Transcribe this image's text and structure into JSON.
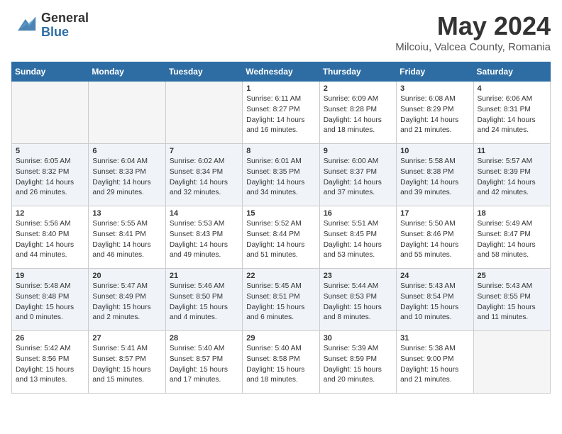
{
  "header": {
    "logo_general": "General",
    "logo_blue": "Blue",
    "month_title": "May 2024",
    "location": "Milcoiu, Valcea County, Romania"
  },
  "days_of_week": [
    "Sunday",
    "Monday",
    "Tuesday",
    "Wednesday",
    "Thursday",
    "Friday",
    "Saturday"
  ],
  "weeks": [
    {
      "cells": [
        {
          "day": null,
          "empty": true
        },
        {
          "day": null,
          "empty": true
        },
        {
          "day": null,
          "empty": true
        },
        {
          "day": 1,
          "sunrise": "6:11 AM",
          "sunset": "8:27 PM",
          "daylight": "14 hours and 16 minutes."
        },
        {
          "day": 2,
          "sunrise": "6:09 AM",
          "sunset": "8:28 PM",
          "daylight": "14 hours and 18 minutes."
        },
        {
          "day": 3,
          "sunrise": "6:08 AM",
          "sunset": "8:29 PM",
          "daylight": "14 hours and 21 minutes."
        },
        {
          "day": 4,
          "sunrise": "6:06 AM",
          "sunset": "8:31 PM",
          "daylight": "14 hours and 24 minutes."
        }
      ]
    },
    {
      "cells": [
        {
          "day": 5,
          "sunrise": "6:05 AM",
          "sunset": "8:32 PM",
          "daylight": "14 hours and 26 minutes."
        },
        {
          "day": 6,
          "sunrise": "6:04 AM",
          "sunset": "8:33 PM",
          "daylight": "14 hours and 29 minutes."
        },
        {
          "day": 7,
          "sunrise": "6:02 AM",
          "sunset": "8:34 PM",
          "daylight": "14 hours and 32 minutes."
        },
        {
          "day": 8,
          "sunrise": "6:01 AM",
          "sunset": "8:35 PM",
          "daylight": "14 hours and 34 minutes."
        },
        {
          "day": 9,
          "sunrise": "6:00 AM",
          "sunset": "8:37 PM",
          "daylight": "14 hours and 37 minutes."
        },
        {
          "day": 10,
          "sunrise": "5:58 AM",
          "sunset": "8:38 PM",
          "daylight": "14 hours and 39 minutes."
        },
        {
          "day": 11,
          "sunrise": "5:57 AM",
          "sunset": "8:39 PM",
          "daylight": "14 hours and 42 minutes."
        }
      ]
    },
    {
      "cells": [
        {
          "day": 12,
          "sunrise": "5:56 AM",
          "sunset": "8:40 PM",
          "daylight": "14 hours and 44 minutes."
        },
        {
          "day": 13,
          "sunrise": "5:55 AM",
          "sunset": "8:41 PM",
          "daylight": "14 hours and 46 minutes."
        },
        {
          "day": 14,
          "sunrise": "5:53 AM",
          "sunset": "8:43 PM",
          "daylight": "14 hours and 49 minutes."
        },
        {
          "day": 15,
          "sunrise": "5:52 AM",
          "sunset": "8:44 PM",
          "daylight": "14 hours and 51 minutes."
        },
        {
          "day": 16,
          "sunrise": "5:51 AM",
          "sunset": "8:45 PM",
          "daylight": "14 hours and 53 minutes."
        },
        {
          "day": 17,
          "sunrise": "5:50 AM",
          "sunset": "8:46 PM",
          "daylight": "14 hours and 55 minutes."
        },
        {
          "day": 18,
          "sunrise": "5:49 AM",
          "sunset": "8:47 PM",
          "daylight": "14 hours and 58 minutes."
        }
      ]
    },
    {
      "cells": [
        {
          "day": 19,
          "sunrise": "5:48 AM",
          "sunset": "8:48 PM",
          "daylight": "15 hours and 0 minutes."
        },
        {
          "day": 20,
          "sunrise": "5:47 AM",
          "sunset": "8:49 PM",
          "daylight": "15 hours and 2 minutes."
        },
        {
          "day": 21,
          "sunrise": "5:46 AM",
          "sunset": "8:50 PM",
          "daylight": "15 hours and 4 minutes."
        },
        {
          "day": 22,
          "sunrise": "5:45 AM",
          "sunset": "8:51 PM",
          "daylight": "15 hours and 6 minutes."
        },
        {
          "day": 23,
          "sunrise": "5:44 AM",
          "sunset": "8:53 PM",
          "daylight": "15 hours and 8 minutes."
        },
        {
          "day": 24,
          "sunrise": "5:43 AM",
          "sunset": "8:54 PM",
          "daylight": "15 hours and 10 minutes."
        },
        {
          "day": 25,
          "sunrise": "5:43 AM",
          "sunset": "8:55 PM",
          "daylight": "15 hours and 11 minutes."
        }
      ]
    },
    {
      "cells": [
        {
          "day": 26,
          "sunrise": "5:42 AM",
          "sunset": "8:56 PM",
          "daylight": "15 hours and 13 minutes."
        },
        {
          "day": 27,
          "sunrise": "5:41 AM",
          "sunset": "8:57 PM",
          "daylight": "15 hours and 15 minutes."
        },
        {
          "day": 28,
          "sunrise": "5:40 AM",
          "sunset": "8:57 PM",
          "daylight": "15 hours and 17 minutes."
        },
        {
          "day": 29,
          "sunrise": "5:40 AM",
          "sunset": "8:58 PM",
          "daylight": "15 hours and 18 minutes."
        },
        {
          "day": 30,
          "sunrise": "5:39 AM",
          "sunset": "8:59 PM",
          "daylight": "15 hours and 20 minutes."
        },
        {
          "day": 31,
          "sunrise": "5:38 AM",
          "sunset": "9:00 PM",
          "daylight": "15 hours and 21 minutes."
        },
        {
          "day": null,
          "empty": true
        }
      ]
    }
  ]
}
